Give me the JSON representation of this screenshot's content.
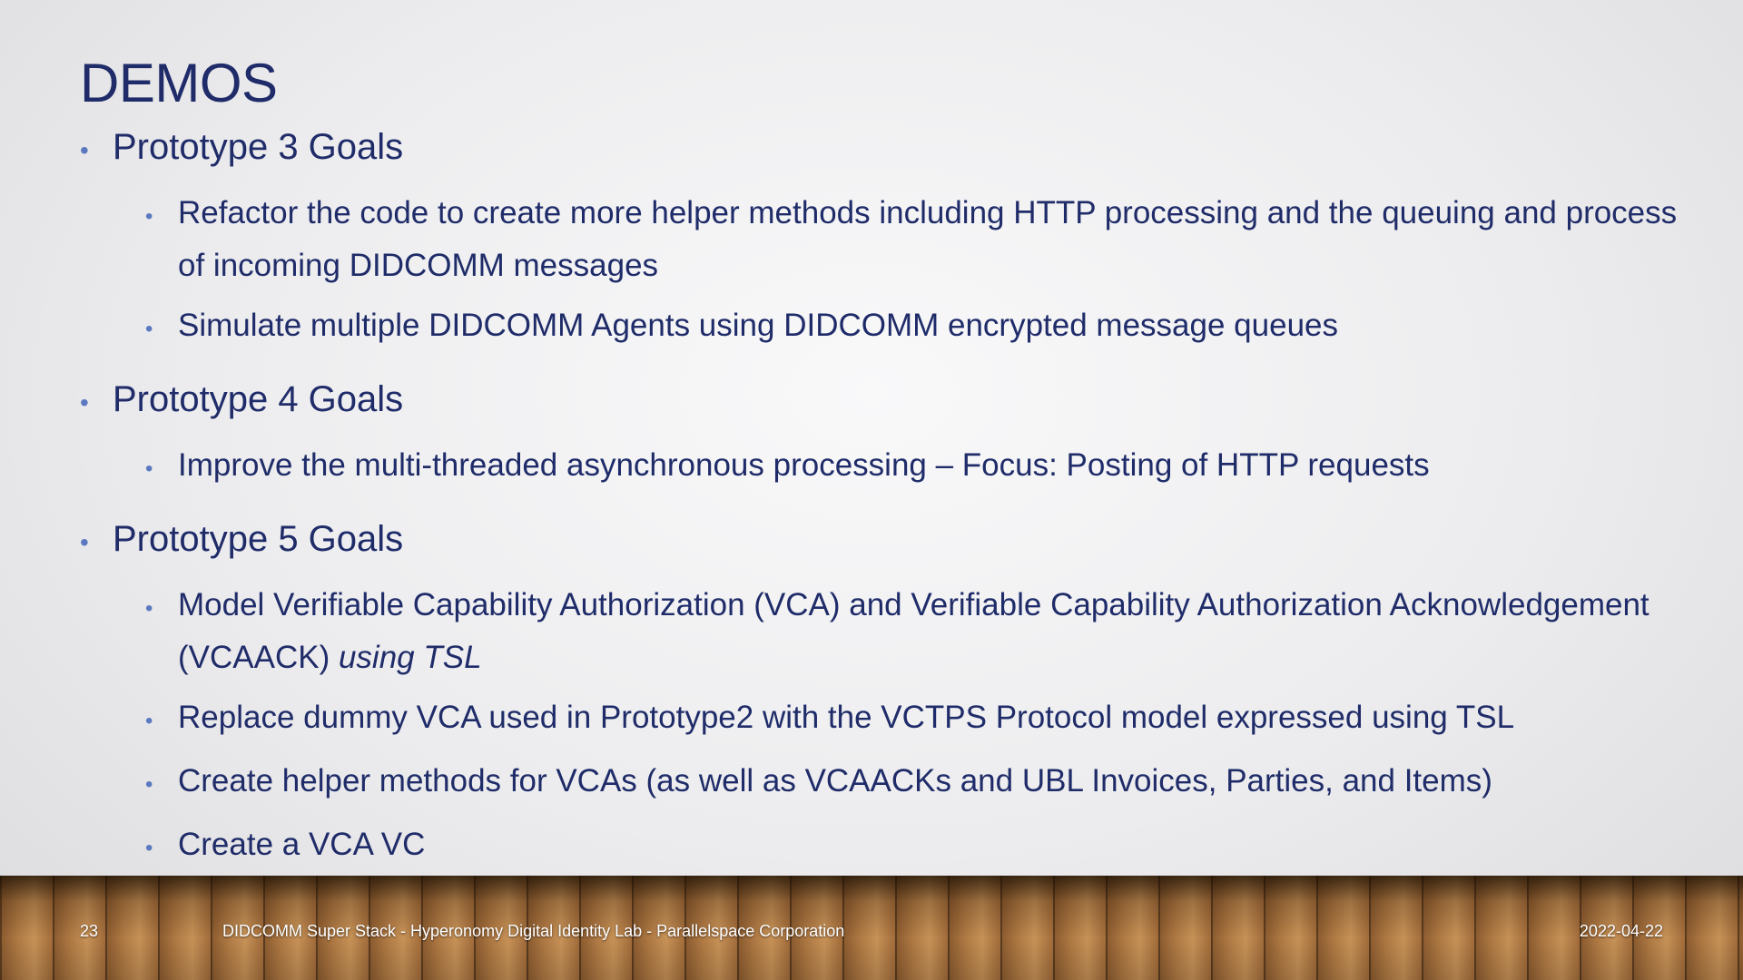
{
  "slide": {
    "title": "DEMOS",
    "bullet_glyph": "•",
    "goals": [
      {
        "heading": "Prototype 3 Goals",
        "items": [
          {
            "text": "Refactor the code to create more helper methods including HTTP processing and the queuing and process of incoming DIDCOMM messages",
            "italic_suffix": ""
          },
          {
            "text": "Simulate multiple DIDCOMM Agents using DIDCOMM encrypted message queues",
            "italic_suffix": ""
          }
        ]
      },
      {
        "heading": "Prototype 4 Goals",
        "items": [
          {
            "text": "Improve the multi-threaded asynchronous processing – Focus: Posting of HTTP requests",
            "italic_suffix": ""
          }
        ]
      },
      {
        "heading": "Prototype 5 Goals",
        "items": [
          {
            "text": "Model Verifiable Capability Authorization (VCA) and Verifiable Capability Authorization Acknowledgement (VCAACK) ",
            "italic_suffix": "using TSL"
          },
          {
            "text": "Replace dummy VCA used in Prototype2 with the VCTPS Protocol model expressed using TSL",
            "italic_suffix": ""
          },
          {
            "text": "Create helper methods for VCAs (as well as VCAACKs and UBL Invoices, Parties, and Items)",
            "italic_suffix": ""
          },
          {
            "text": "Create a VCA VC",
            "italic_suffix": ""
          }
        ]
      }
    ]
  },
  "footer": {
    "page_number": "23",
    "center_text": "DIDCOMM Super Stack - Hyperonomy Digital Identity Lab - Parallelspace Corporation",
    "date": "2022-04-22"
  },
  "colors": {
    "title": "#1f2c69",
    "body_text": "#1f2c69",
    "bullet": "#5a79c0",
    "footer_text": "#ffffff"
  }
}
